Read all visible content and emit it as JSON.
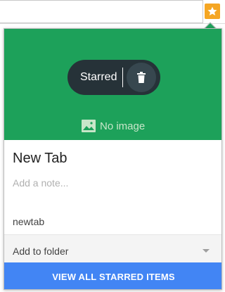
{
  "colors": {
    "hero_background": "#1da15a",
    "pill_background": "#263238",
    "star_accent": "#f5a623",
    "primary_button": "#4285f4"
  },
  "toolbar": {
    "star_icon": "star-icon"
  },
  "bubble": {
    "status_label": "Starred",
    "delete_icon": "trash-icon",
    "no_image_label": "No image",
    "title": "New Tab",
    "note_placeholder": "Add a note...",
    "url": "newtab",
    "folder_label": "Add to folder",
    "view_all_label": "VIEW ALL STARRED ITEMS"
  }
}
